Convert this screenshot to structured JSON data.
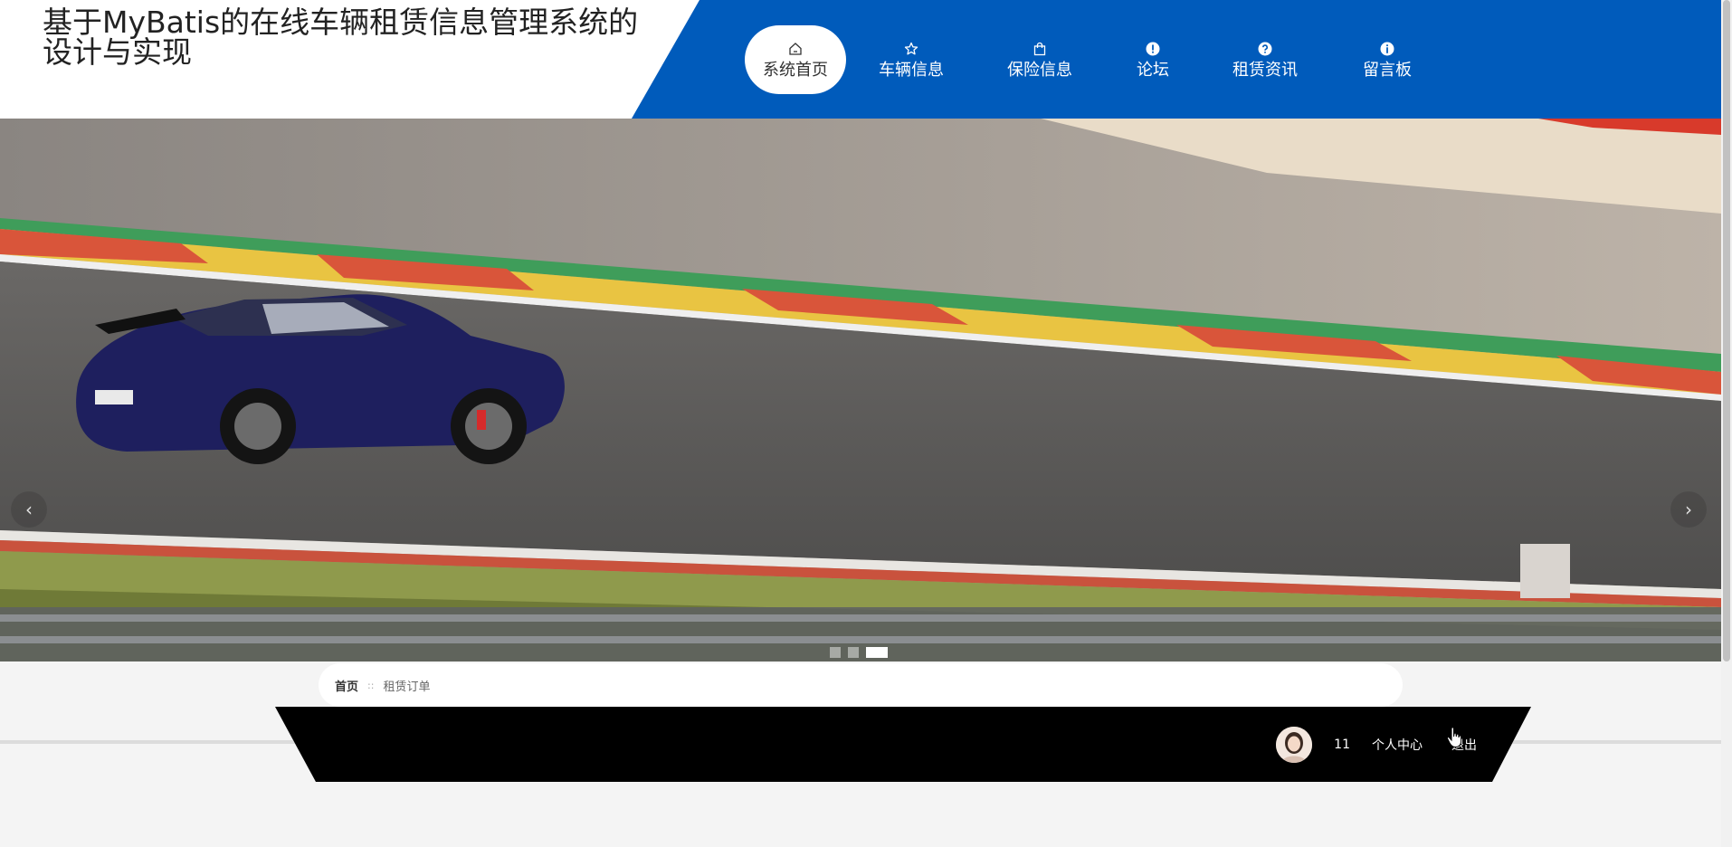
{
  "header": {
    "site_title": "基于MyBatis的在线车辆租赁信息管理系统的设计与实现"
  },
  "nav": {
    "items": [
      {
        "label": "系统首页",
        "icon": "home-icon",
        "active": true
      },
      {
        "label": "车辆信息",
        "icon": "star-icon",
        "active": false
      },
      {
        "label": "保险信息",
        "icon": "bag-icon",
        "active": false
      },
      {
        "label": "论坛",
        "icon": "exclamation-icon",
        "active": false
      },
      {
        "label": "租赁资讯",
        "icon": "question-icon",
        "active": false
      },
      {
        "label": "留言板",
        "icon": "info-icon",
        "active": false
      }
    ]
  },
  "banner": {
    "image": "blue-sports-car-on-racetrack",
    "prev_arrow": "‹",
    "next_arrow": "›",
    "slides_count": 3,
    "active_slide": 3
  },
  "breadcrumb": {
    "home": "首页",
    "separator": "::",
    "current": "租赁订单"
  },
  "user": {
    "username": "11",
    "center_label": "个人中心",
    "logout_label": "退出"
  },
  "colors": {
    "nav_bg": "#005bbb",
    "userbar_bg": "#000000",
    "page_bg": "#f4f4f4"
  }
}
